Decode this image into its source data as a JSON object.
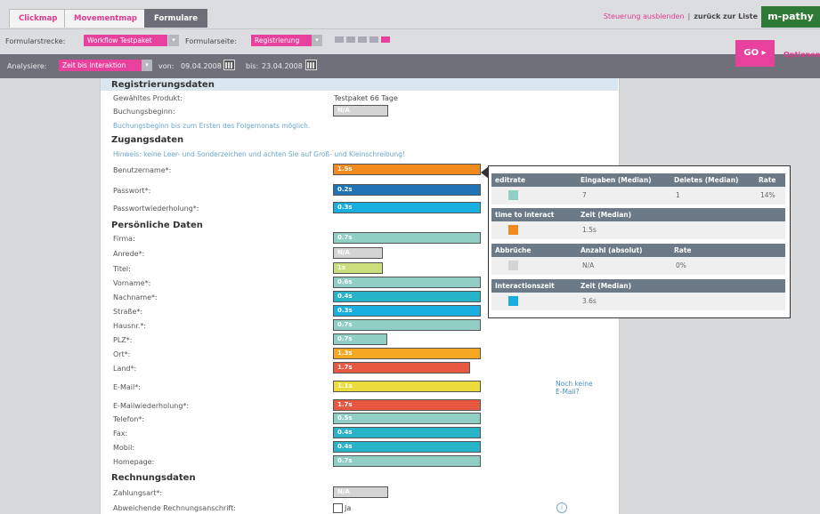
{
  "nav": {
    "tabs": [
      {
        "label": "Clickmap"
      },
      {
        "label": "Movementmap"
      },
      {
        "label": "Formulare"
      }
    ],
    "hide_controls": "Steuerung ausblenden",
    "separator": "|",
    "back_to_list": "zurück zur Liste",
    "logo": "m-pathy"
  },
  "filters": {
    "route_label": "Formularstrecke:",
    "route_value": "Workflow Testpaket",
    "page_label": "Formularseite:",
    "page_value": "Registrierung",
    "analyze_label": "Analysiere:",
    "analyze_value": "Zeit bis Interaktion",
    "from_label": "von:",
    "from_value": "09.04.2008",
    "to_label": "bis:",
    "to_value": "23.04.2008",
    "go": "GO ▸",
    "options": "Optionen"
  },
  "colors": {
    "orange": "#f28a1e",
    "blue_dark": "#1f74b8",
    "blue": "#19aee0",
    "teal": "#8fcfc4",
    "gray": "#d4d4d4",
    "lime": "#c9df7b",
    "teal_dark": "#27b4c9",
    "orange_light": "#f7a823",
    "red": "#e8573f",
    "yellow": "#ecdd3c",
    "pink": "#e7409d"
  },
  "form": {
    "sections": [
      {
        "title": "Registrierungsdaten"
      },
      {
        "title": "Zugangsdaten"
      },
      {
        "title": "Persönliche Daten"
      },
      {
        "title": "Rechnungsdaten"
      }
    ],
    "product_label": "Gewähltes Produkt:",
    "product_value": "Testpaket 66 Tage",
    "booking_label": "Buchungsbeginn:",
    "booking_bar": "N/A",
    "booking_hint": "Buchungsbeginn bis zum Ersten des Folgemonats möglich.",
    "access_hint": "Hinweis: keine Leer- und Sonderzeichen und achten Sie auf Groß- und Kleinschreibung!",
    "access_fields": [
      {
        "label": "Benutzername*:",
        "value": "1.5s",
        "color": "#f28a1e",
        "fill": 1.0
      },
      {
        "label": "Passwort*:",
        "value": "0.2s",
        "color": "#1f74b8",
        "fill": 1.0
      },
      {
        "label": "Passwortwiederholung*:",
        "value": "0.3s",
        "color": "#19aee0",
        "fill": 1.0
      }
    ],
    "personal_fields": [
      {
        "label": "Firma:",
        "value": "0.7s",
        "color": "#8fcfc4",
        "fill": 1.0
      },
      {
        "label": "Anrede*:",
        "value": "N/A",
        "color": "#d4d4d4",
        "fill": 0.34
      },
      {
        "label": "Titel:",
        "value": "1s",
        "color": "#c9df7b",
        "fill": 0.34
      },
      {
        "label": "Vorname*:",
        "value": "0.6s",
        "color": "#8fcfc4",
        "fill": 1.0
      },
      {
        "label": "Nachname*:",
        "value": "0.4s",
        "color": "#27b4c9",
        "fill": 1.0
      },
      {
        "label": "Straße*:",
        "value": "0.3s",
        "color": "#19aee0",
        "fill": 1.0
      },
      {
        "label": "Hausnr.*:",
        "value": "0.7s",
        "color": "#8fcfc4",
        "fill": 1.0
      },
      {
        "label": "PLZ*:",
        "value": "0.7s",
        "color": "#8fcfc4",
        "fill": 0.37
      },
      {
        "label": "Ort*:",
        "value": "1.3s",
        "color": "#f7a823",
        "fill": 1.0
      },
      {
        "label": "Land*:",
        "value": "1.7s",
        "color": "#e8573f",
        "fill": 0.93
      },
      {
        "label": "E-Mail*:",
        "value": "1.1s",
        "color": "#ecdd3c",
        "fill": 1.0
      },
      {
        "label": "E-Mailwiederholung*:",
        "value": "1.7s",
        "color": "#e8573f",
        "fill": 1.0
      },
      {
        "label": "Telefon*:",
        "value": "0.5s",
        "color": "#8fcfc4",
        "fill": 1.0
      },
      {
        "label": "Fax:",
        "value": "0.4s",
        "color": "#27b4c9",
        "fill": 1.0
      },
      {
        "label": "Mobil:",
        "value": "0.4s",
        "color": "#27b4c9",
        "fill": 1.0
      },
      {
        "label": "Homepage:",
        "value": "0.7s",
        "color": "#8fcfc4",
        "fill": 1.0
      }
    ],
    "no_email": [
      "Noch keine",
      "E-Mail?"
    ],
    "payment_label": "Zahlungsart*:",
    "payment_bar": "N/A",
    "alt_address_label": "Abweichende Rechnungsanschrift:",
    "alt_address_option": "Ja",
    "info_glyph": "i"
  },
  "popup": {
    "edit": {
      "headers": [
        "editrate",
        "Eingaben (Median)",
        "Deletes (Median)",
        "Rate"
      ],
      "values": [
        "7",
        "1",
        "14%"
      ],
      "color": "#8fcfc4"
    },
    "interact": {
      "headers": [
        "time to interact",
        "Zeit (Median)"
      ],
      "values": [
        "1.5s"
      ],
      "color": "#f28a1e"
    },
    "abort": {
      "headers": [
        "Abbrüche",
        "Anzahl (absolut)",
        "Rate"
      ],
      "values": [
        "N/A",
        "0%"
      ],
      "color": "#d4d4d4"
    },
    "interaction_time": {
      "headers": [
        "Interactionszeit",
        "Zeit (Median)"
      ],
      "values": [
        "3.6s"
      ],
      "color": "#19aee0"
    }
  }
}
